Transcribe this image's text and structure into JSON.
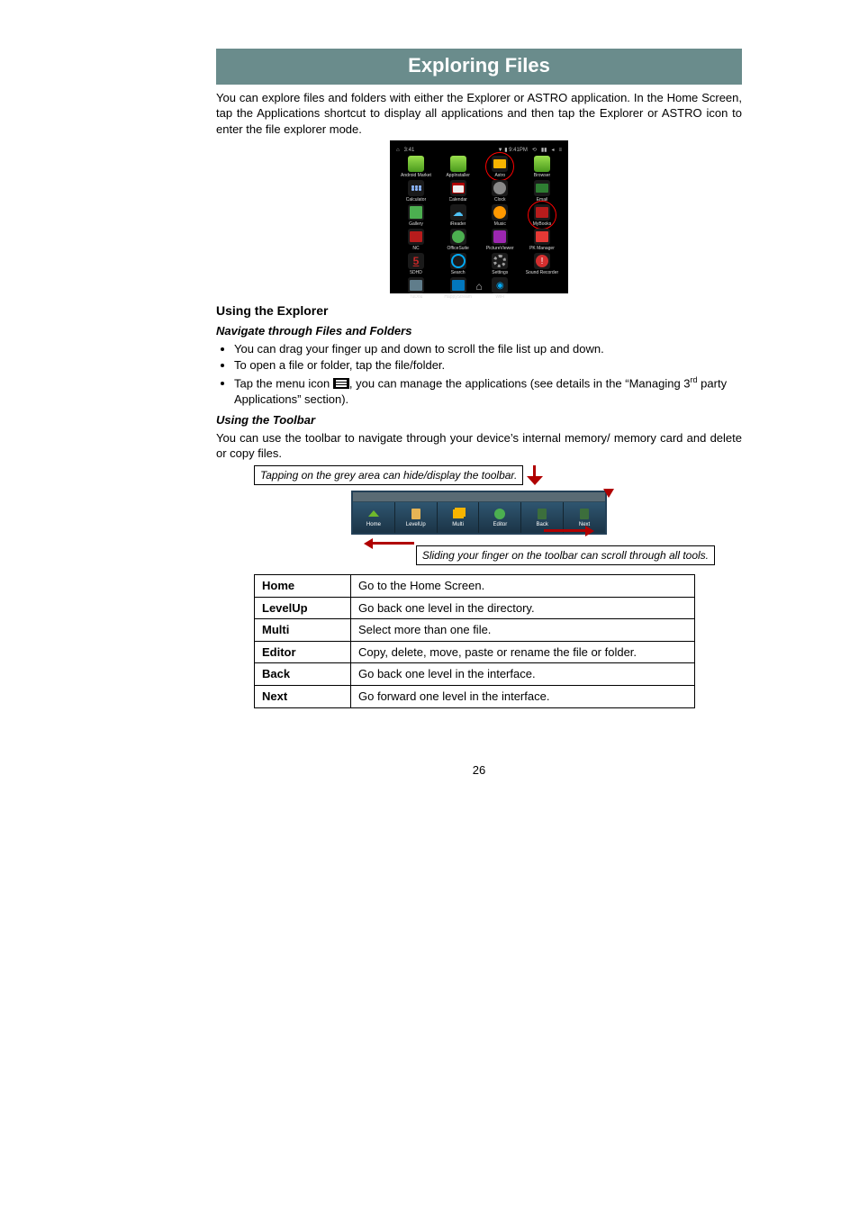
{
  "title": "Exploring Files",
  "intro": "You can explore files and folders with either the Explorer or ASTRO application. In the Home Screen, tap the Applications shortcut to display all applications and then tap the Explorer or ASTRO icon to enter the file explorer mode.",
  "section1_heading": "Using the Explorer",
  "section1_sub1": "Navigate through Files and Folders",
  "bullets": [
    "You can drag your finger up and down to scroll the file list up and down.",
    "To open a file or folder, tap the file/folder."
  ],
  "bullet3_before": "Tap the menu icon ",
  "bullet3_after_a": ", you can manage the applications (see details in the “Managing 3",
  "bullet3_sup": "rd",
  "bullet3_after_b": " party Applications” section).",
  "section1_sub2": "Using the Toolbar",
  "toolbar_para": "You can use the toolbar to navigate through your device’s internal memory/ memory card and delete or copy files.",
  "callout1": "Tapping on the grey area can hide/display the toolbar.",
  "callout2": "Sliding your finger on the toolbar can scroll through all tools.",
  "toolbar_labels": {
    "home": "Home",
    "levelup": "LevelUp",
    "multi": "Multi",
    "editor": "Editor",
    "back": "Back",
    "next": "Next"
  },
  "table": [
    {
      "term": "Home",
      "desc": "Go to the Home Screen."
    },
    {
      "term": "LevelUp",
      "desc": "Go back one level in the directory."
    },
    {
      "term": "Multi",
      "desc": "Select more than one file."
    },
    {
      "term": "Editor",
      "desc": "Copy, delete, move, paste or rename the file or folder."
    },
    {
      "term": "Back",
      "desc": "Go back one level in the interface."
    },
    {
      "term": "Next",
      "desc": "Go forward one level in the interface."
    }
  ],
  "app_icons": [
    [
      "Android Market",
      "AppInstaller",
      "Astro",
      "Browser"
    ],
    [
      "Calculator",
      "Calendar",
      "Clock",
      "Email"
    ],
    [
      "Gallery",
      "iReader",
      "Music",
      "MyBooks"
    ],
    [
      "NC",
      "OfficeSuite",
      "PictureViewer",
      "PK Manager"
    ],
    [
      "5DHD",
      "Search",
      "Settings",
      "Sound Recorder"
    ],
    [
      "TuDou",
      "HappyStream",
      "WiFi",
      ""
    ]
  ],
  "page_number": "26"
}
